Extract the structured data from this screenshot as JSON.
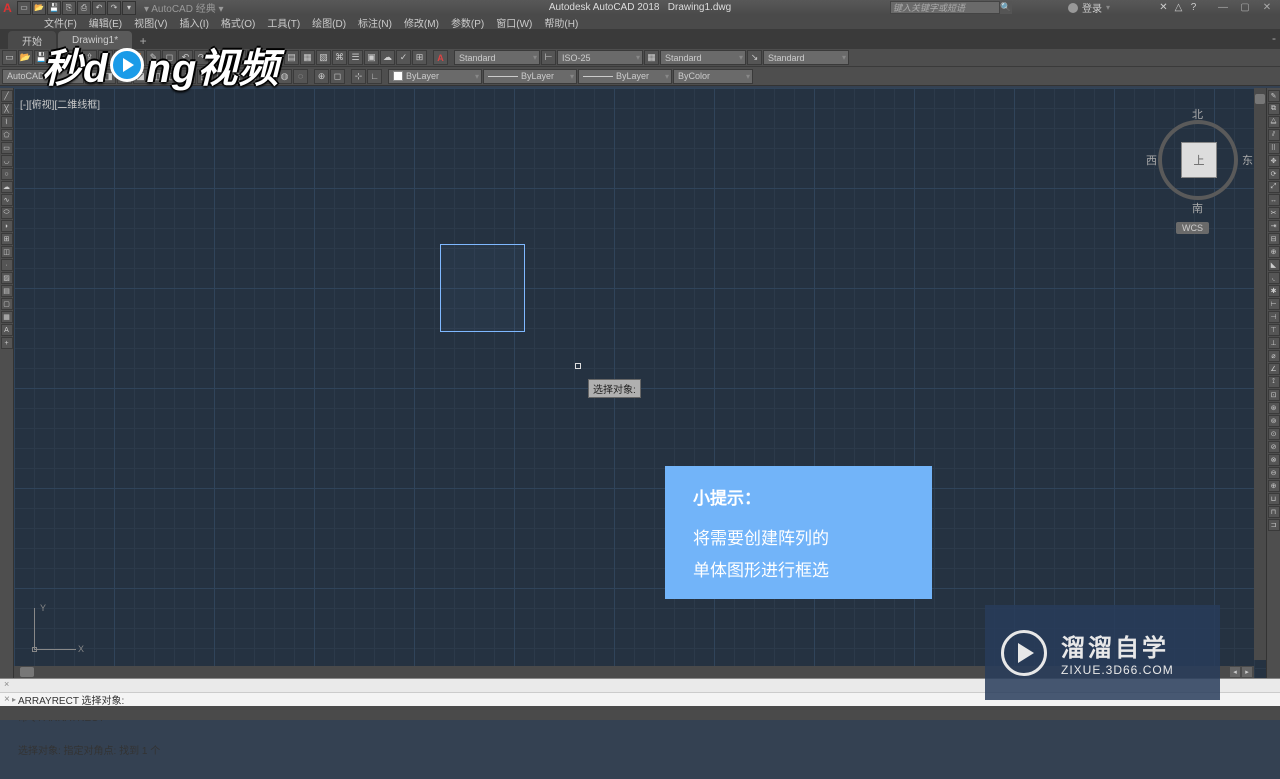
{
  "title": {
    "app": "Autodesk AutoCAD 2018",
    "doc": "Drawing1.dwg",
    "workspace": "AutoCAD 经典"
  },
  "search": {
    "placeholder": "键入关键字或短语"
  },
  "login": {
    "label": "登录"
  },
  "menu": {
    "items": [
      "文件(F)",
      "编辑(E)",
      "视图(V)",
      "插入(I)",
      "格式(O)",
      "工具(T)",
      "绘图(D)",
      "标注(N)",
      "修改(M)",
      "参数(P)",
      "窗口(W)",
      "帮助(H)"
    ]
  },
  "tabs": {
    "start": "开始",
    "doc": "Drawing1*"
  },
  "combos": {
    "layer": "ByLayer",
    "textstyle": "Standard",
    "dimstyle": "ISO-25",
    "tablestyle": "Standard",
    "mlstyle": "Standard",
    "autocad": "AutoCAD",
    "color": "ByLayer",
    "ltype": "ByLayer",
    "lweight": "ByLayer",
    "plotstyle": "ByColor"
  },
  "viewport": {
    "label": "[-][俯视][二维线框]"
  },
  "viewcube": {
    "n": "北",
    "s": "南",
    "e": "东",
    "w": "西",
    "top": "上",
    "wcs": "WCS"
  },
  "ucs": {
    "x": "X",
    "y": "Y"
  },
  "tooltip": {
    "text": "选择对象:"
  },
  "tip": {
    "title": "小提示：",
    "line1": "将需要创建阵列的",
    "line2": "单体图形进行框选"
  },
  "brand": {
    "seg1": "秒d",
    "seg2": "ng视频"
  },
  "siteBrand": {
    "name": "溜溜自学",
    "url": "ZIXUE.3D66.COM"
  },
  "cmd": {
    "hist1": "命令: ARRAYRECT",
    "hist2": "选择对象: 指定对角点: 找到 1 个",
    "prompt": "ARRAYRECT 选择对象:"
  }
}
